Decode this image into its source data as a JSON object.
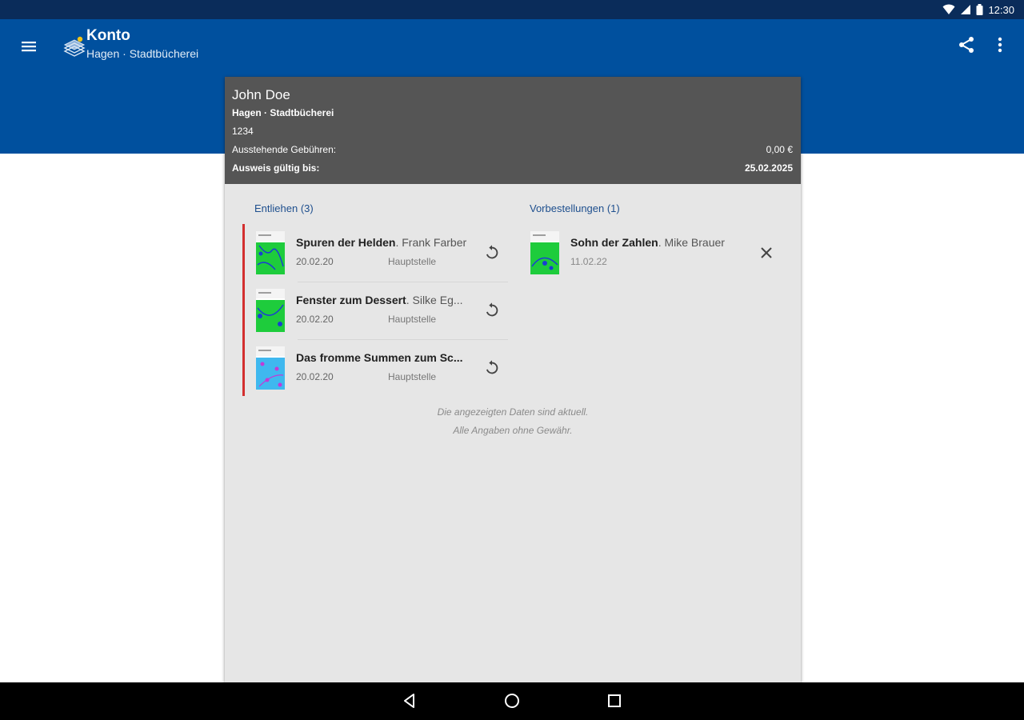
{
  "status_bar": {
    "time": "12:30"
  },
  "app_bar": {
    "title": "Konto",
    "subtitle": "Hagen · Stadtbücherei"
  },
  "account": {
    "name": "John Doe",
    "library": "Hagen · Stadtbücherei",
    "card_number": "1234",
    "fees_label": "Ausstehende Gebühren:",
    "fees_value": "0,00 €",
    "valid_label": "Ausweis gültig bis:",
    "valid_value": "25.02.2025"
  },
  "lent": {
    "title": "Entliehen (3)",
    "items": [
      {
        "title": "Spuren der Helden",
        "author": ". Frank Farber",
        "date": "20.02.20",
        "branch": "Hauptstelle"
      },
      {
        "title": "Fenster zum Dessert",
        "author": ". Silke Eg...",
        "date": "20.02.20",
        "branch": "Hauptstelle"
      },
      {
        "title": "Das fromme Summen zum Sc...",
        "author": "",
        "date": "20.02.20",
        "branch": "Hauptstelle"
      }
    ]
  },
  "reservations": {
    "title": "Vorbestellungen (1)",
    "items": [
      {
        "title": "Sohn der Zahlen",
        "author": ". Mike Brauer",
        "date": "11.02.22"
      }
    ]
  },
  "footer": {
    "line1": "Die angezeigten Daten sind aktuell.",
    "line2": "Alle Angaben ohne Gewähr."
  },
  "colors": {
    "app_bar": "#00509e",
    "status_bar": "#0a2c5a",
    "card_header": "#555555",
    "section_title": "#1e4f8e",
    "overdue_bar": "#d32f2f"
  },
  "icons": {
    "menu": "menu-icon",
    "share": "share-icon",
    "more": "more-vert-icon",
    "renew": "renew-icon",
    "cancel": "close-icon"
  }
}
